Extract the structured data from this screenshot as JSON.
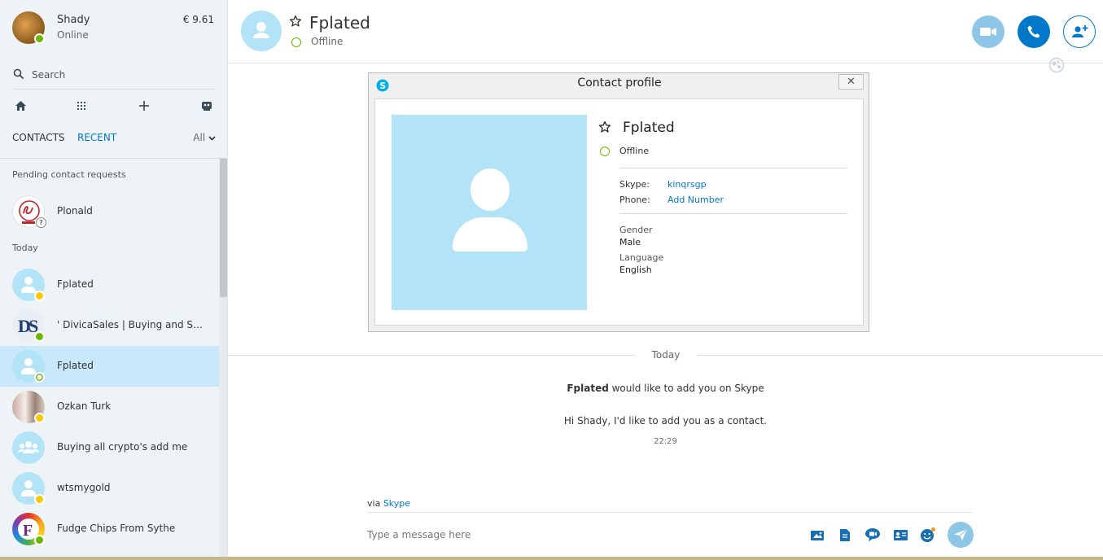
{
  "me": {
    "name": "Shady",
    "status": "Online",
    "credit": "€ 9.61"
  },
  "search": {
    "placeholder": "Search"
  },
  "tabs": {
    "contacts": "CONTACTS",
    "recent": "RECENT",
    "filter": "All"
  },
  "sections": {
    "pending": "Pending contact requests",
    "today": "Today"
  },
  "pending": [
    {
      "name": "Plonald"
    }
  ],
  "recent": [
    {
      "name": "Fplated",
      "status": "away"
    },
    {
      "name": "' DivicaSales | Buying and Sell...",
      "status": "online"
    },
    {
      "name": "Fplated",
      "status": "offline",
      "selected": true
    },
    {
      "name": "Ozkan Turk",
      "status": "away"
    },
    {
      "name": "Buying all crypto's add me",
      "status": "group"
    },
    {
      "name": "wtsmygold",
      "status": "away"
    },
    {
      "name": "Fudge Chips From Sythe",
      "status": "online"
    }
  ],
  "header": {
    "name": "Fplated",
    "status": "Offline"
  },
  "dialog": {
    "title": "Contact profile",
    "close": "✕",
    "name": "Fplated",
    "status": "Offline",
    "skype_label": "Skype:",
    "skype_value": "kinqrsgp",
    "phone_label": "Phone:",
    "phone_value": "Add Number",
    "gender_label": "Gender",
    "gender_value": "Male",
    "language_label": "Language",
    "language_value": "English"
  },
  "conversation": {
    "day": "Today",
    "requester": "Fplated",
    "request_text": " would like to add you on Skype",
    "message": "Hi Shady, I'd like to add you as a contact.",
    "time": "22:29"
  },
  "compose": {
    "via_prefix": "via ",
    "via_link": "Skype",
    "placeholder": "Type a message here"
  },
  "colors": {
    "accent": "#0078ca",
    "sidebar_bg": "#eef3f7",
    "selected_bg": "#c7e9fb",
    "avatar_bg": "#b3e3f7",
    "online": "#6bb700",
    "away": "#ffc800"
  }
}
